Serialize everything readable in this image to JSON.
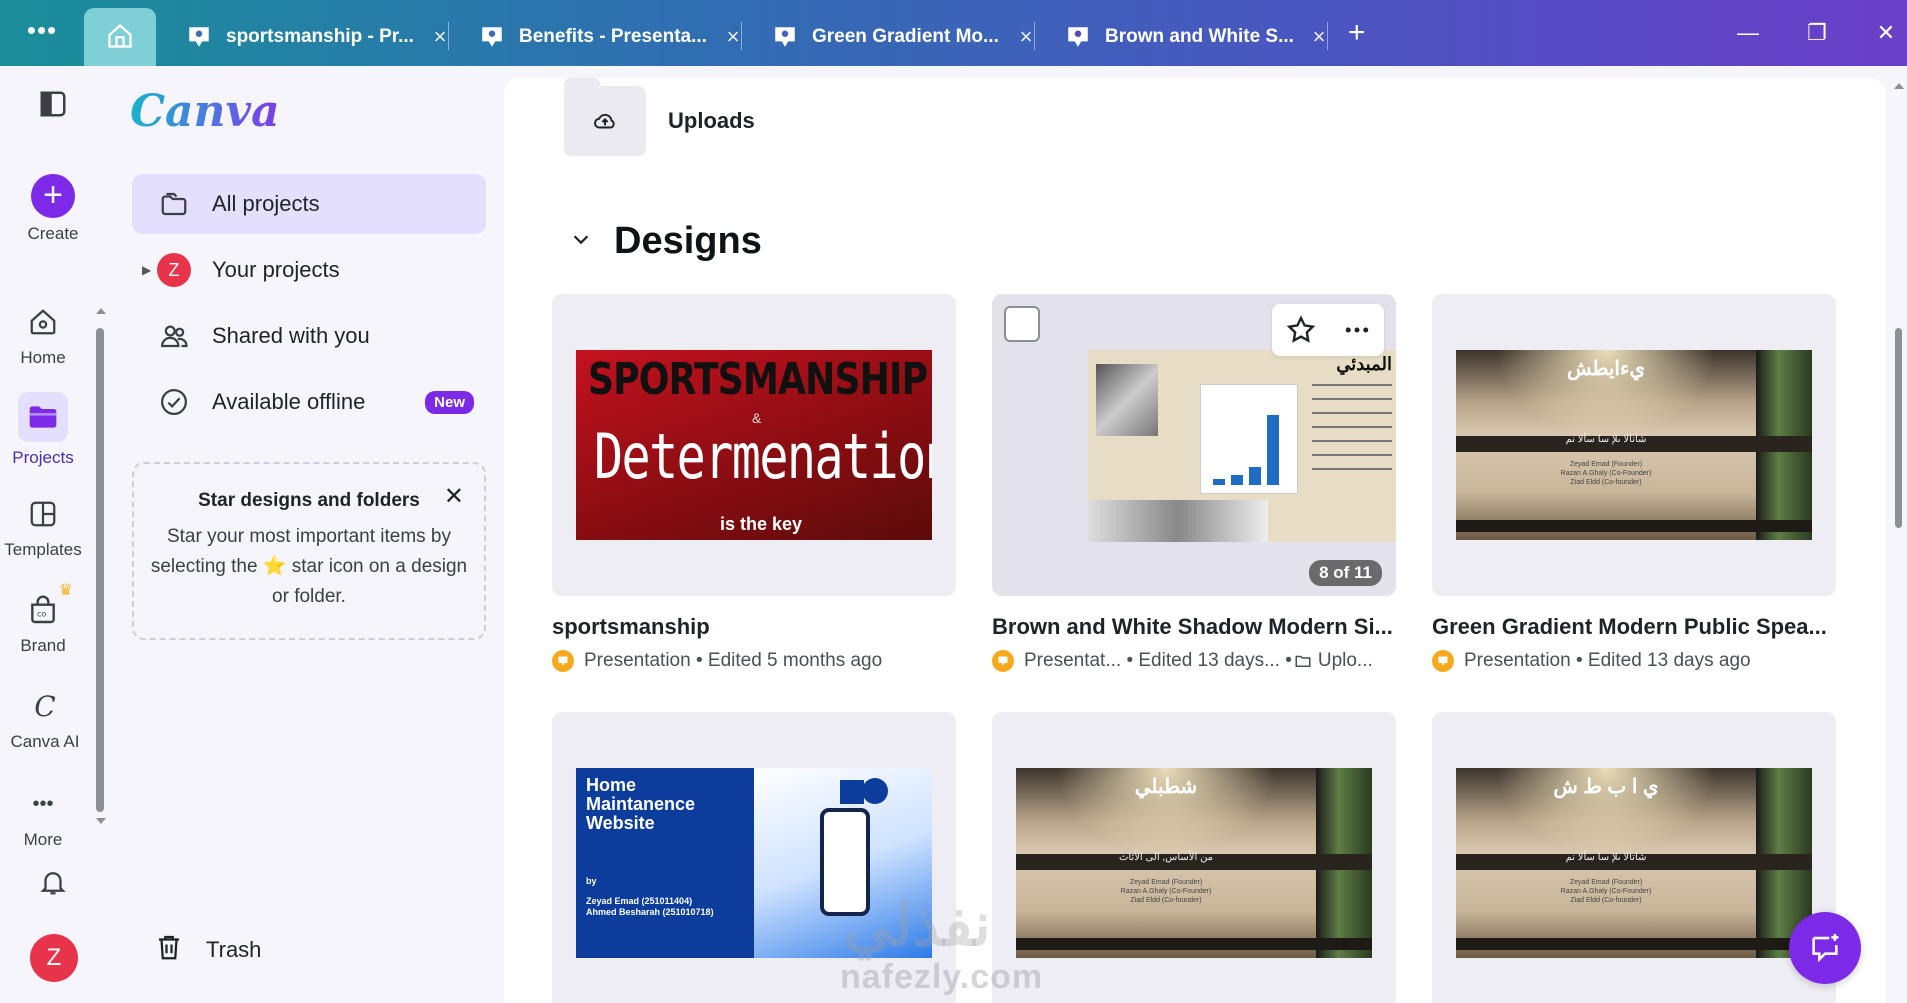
{
  "tabs": [
    {
      "label": "sportsmanship - Pr...",
      "close": "×"
    },
    {
      "label": "Benefits - Presenta...",
      "close": "×"
    },
    {
      "label": "Green Gradient Mo...",
      "close": "×"
    },
    {
      "label": "Brown and White S...",
      "close": "×"
    }
  ],
  "tabbar": {
    "menu": "•••",
    "new_tab": "+",
    "minimize": "—",
    "restore": "❐",
    "close": "✕"
  },
  "rail": {
    "create": "Create",
    "home": "Home",
    "projects": "Projects",
    "templates": "Templates",
    "brand": "Brand",
    "canva_ai": "Canva AI",
    "more": "More",
    "more_dots": "•••",
    "avatar": "Z"
  },
  "sidebar": {
    "logo": "Canva",
    "all_projects": "All projects",
    "your_projects": "Your projects",
    "your_projects_avatar": "Z",
    "shared": "Shared with you",
    "offline": "Available offline",
    "new_badge": "New",
    "star_card": {
      "title": "Star designs and folders",
      "body_before": "Star your most important items by selecting the",
      "star_emoji": "⭐",
      "body_after": "star icon on a design or folder.",
      "close": "✕"
    },
    "trash": "Trash"
  },
  "main": {
    "uploads_label": "Uploads",
    "designs_heading": "Designs",
    "cards": [
      {
        "title": "sportsmanship",
        "type": "Presentation",
        "edited": "• Edited 5 months ago"
      },
      {
        "title": "Brown and White Shadow Modern Si...",
        "type": "Presentat...",
        "edited": "• Edited 13 days...",
        "folder": "• ",
        "folder_name": "Uplo...",
        "page_badge": "8 of 11"
      },
      {
        "title": "Green Gradient Modern Public Spea...",
        "type": "Presentation",
        "edited": "• Edited 13 days ago"
      }
    ],
    "thumbs": {
      "sport_title": "SPORTSMANSHIP",
      "sport_amp": "&",
      "sport_word": "Determenation",
      "sport_sub": "is the key",
      "brown_title": "المبدئي",
      "room1_title": "يءايطش",
      "room1_sub": "شاتالا ىلإ سا سألا نم",
      "room1_names": "Zeyad Emad (Founder)\nRazan A.Ghaly (Co-Founder)\nZiad Eldd (Co-founder)",
      "home_title": "Home\nMaintanence\nWebsite",
      "home_by": "by",
      "home_authors": "Zeyad Emad (251011404)\nAhmed Besharah (251010718)",
      "room2_title": "شطبلي",
      "room2_sub": "من الأساس, الى الأثاث",
      "room2_names": "Zeyad Emad (Founder)\nRazan A.Ghaly (Co-Founder)\nZiad Eldd (Co-founder)",
      "room3_title": "ي ا ب ط ش",
      "room3_sub": "شاتالا ىلإ سا سألا نم",
      "room3_names": "Zeyad Emad (Founder)\nRazan A.Ghaly (Co-Founder)\nZiad Eldd (Co-founder)"
    }
  },
  "watermark": {
    "ar": "نفذلي",
    "en": "nafezly.com"
  },
  "colors": {
    "accent": "#7d2ae8",
    "active_bg": "#e4e0fb",
    "avatar": "#e8344a"
  }
}
